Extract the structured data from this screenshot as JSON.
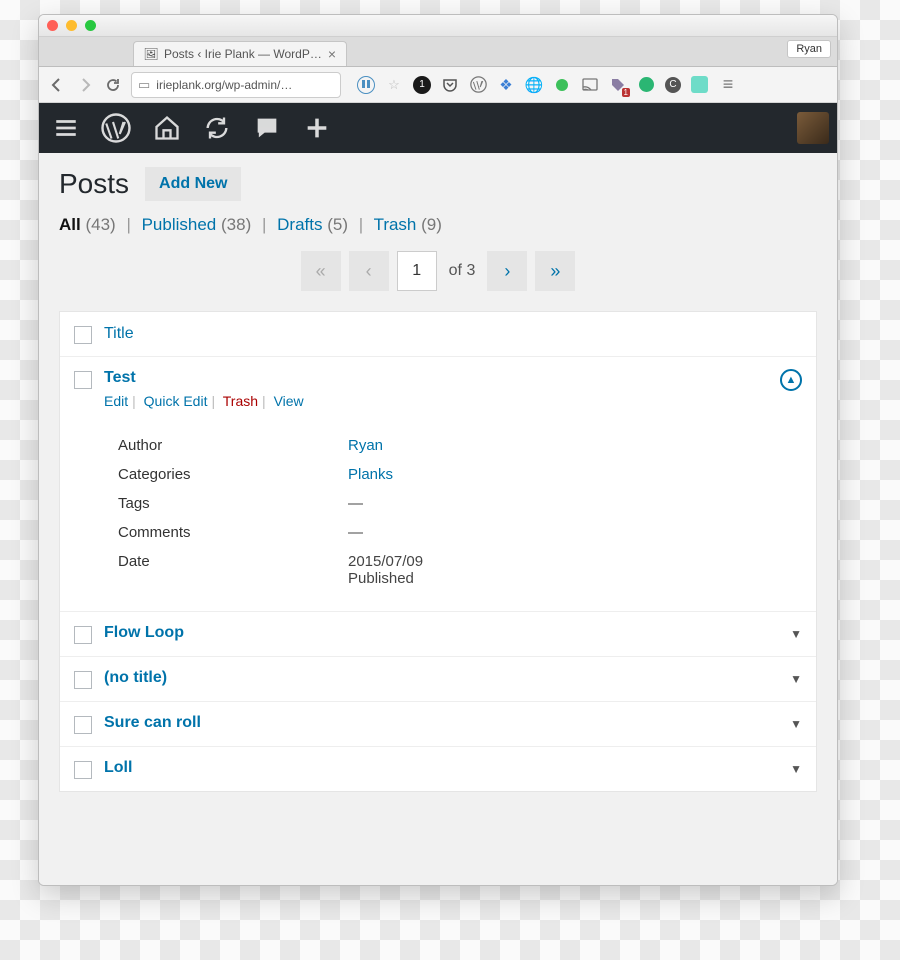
{
  "browser": {
    "tab_title": "Posts ‹ Irie Plank — WordP…",
    "user_chip": "Ryan",
    "url": "irieplank.org/wp-admin/…"
  },
  "page": {
    "title": "Posts",
    "add_new": "Add New"
  },
  "filters": {
    "all_label": "All",
    "all_count": "(43)",
    "published_label": "Published",
    "published_count": "(38)",
    "drafts_label": "Drafts",
    "drafts_count": "(5)",
    "trash_label": "Trash",
    "trash_count": "(9)"
  },
  "pager": {
    "first": "«",
    "prev": "‹",
    "page": "1",
    "of_text": "of 3",
    "next": "›",
    "last": "»"
  },
  "columns": {
    "title": "Title"
  },
  "posts": [
    {
      "title": "Test",
      "expanded": true,
      "actions": {
        "edit": "Edit",
        "quickedit": "Quick Edit",
        "trash": "Trash",
        "view": "View"
      },
      "meta": {
        "author_label": "Author",
        "author_value": "Ryan",
        "categories_label": "Categories",
        "categories_value": "Planks",
        "tags_label": "Tags",
        "tags_value": "—",
        "comments_label": "Comments",
        "comments_value": "—",
        "date_label": "Date",
        "date_value": "2015/07/09",
        "date_status": "Published"
      }
    },
    {
      "title": "Flow Loop",
      "expanded": false
    },
    {
      "title": "(no title)",
      "expanded": false
    },
    {
      "title": "Sure can roll",
      "expanded": false
    },
    {
      "title": "Loll",
      "expanded": false
    }
  ]
}
